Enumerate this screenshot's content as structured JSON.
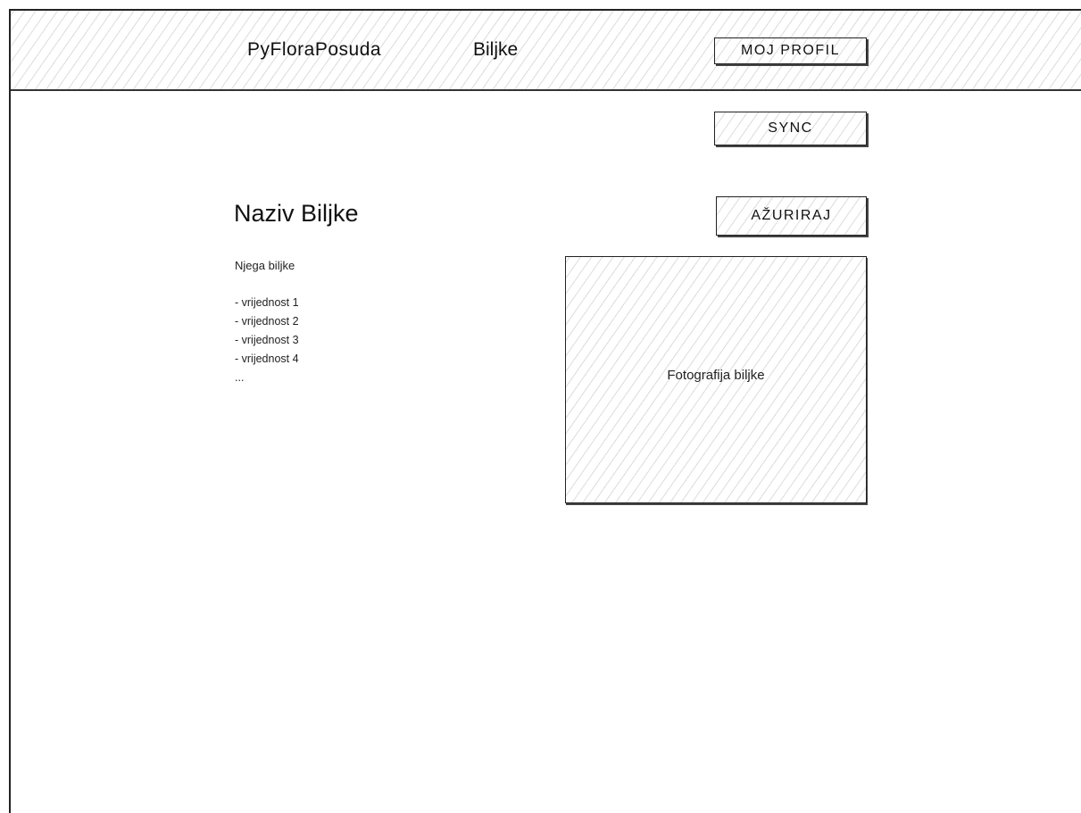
{
  "header": {
    "logo": "PyFloraPosuda",
    "nav_link": "Biljke",
    "profile_button": "MOJ PROFIL"
  },
  "actions": {
    "sync_button": "SYNC",
    "update_button": "AŽURIRAJ"
  },
  "plant": {
    "name": "Naziv Biljke",
    "care_title": "Njega biljke",
    "care_items": [
      "- vrijednost 1",
      "- vrijednost 2",
      "- vrijednost 3",
      "- vrijednost 4",
      "..."
    ],
    "photo_label": "Fotografija biljke"
  },
  "style": {
    "stroke_color": "#222222",
    "hatch_color": "#dcdcdc",
    "background": "#ffffff"
  }
}
